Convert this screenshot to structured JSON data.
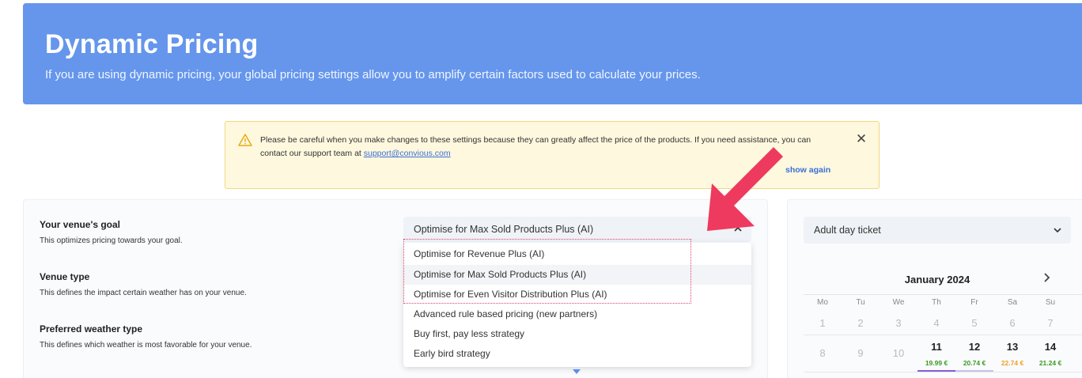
{
  "header": {
    "title": "Dynamic Pricing",
    "subtitle": "If you are using dynamic pricing, your global pricing settings allow you to amplify certain factors used to calculate your prices."
  },
  "warning": {
    "text_before": "Please be careful when you make changes to these settings because they can greatly affect the price of the products. If you need assistance, you can contact our support team at ",
    "link": "support@convious.com",
    "show_again": "show again"
  },
  "settings": {
    "goal": {
      "label": "Your venue's goal",
      "desc": "This optimizes pricing towards your goal."
    },
    "venue_type": {
      "label": "Venue type",
      "desc": "This defines the impact certain weather has on your venue."
    },
    "weather": {
      "label": "Preferred weather type",
      "desc": "This defines which weather is most favorable for your venue."
    }
  },
  "goal_select": {
    "value": "Optimise for Max Sold Products Plus (AI)",
    "options": [
      "Optimise for Revenue Plus (AI)",
      "Optimise for Max Sold Products Plus (AI)",
      "Optimise for Even Visitor Distribution Plus (AI)",
      "Advanced rule based pricing (new partners)",
      "Buy first, pay less strategy",
      "Early bird strategy"
    ],
    "selected_index": 1
  },
  "calendar": {
    "ticket": "Adult day ticket",
    "month": "January 2024",
    "weekdays": [
      "Mo",
      "Tu",
      "We",
      "Th",
      "Fr",
      "Sa",
      "Su"
    ],
    "row1": [
      "1",
      "2",
      "3",
      "4",
      "5",
      "6",
      "7"
    ],
    "row2": [
      "8",
      "9",
      "10",
      "11",
      "12",
      "13",
      "14"
    ],
    "prices": [
      {
        "value": "19.99 €",
        "color": "#3a9a20"
      },
      {
        "value": "20.74 €",
        "color": "#3a9a20"
      },
      {
        "value": "22.74 €",
        "color": "#f0a020"
      },
      {
        "value": "21.24 €",
        "color": "#3a9a20"
      }
    ]
  },
  "colors": {
    "header": "#6596ec",
    "accent": "#3b6fd8",
    "arrow": "#ee3a5e"
  }
}
